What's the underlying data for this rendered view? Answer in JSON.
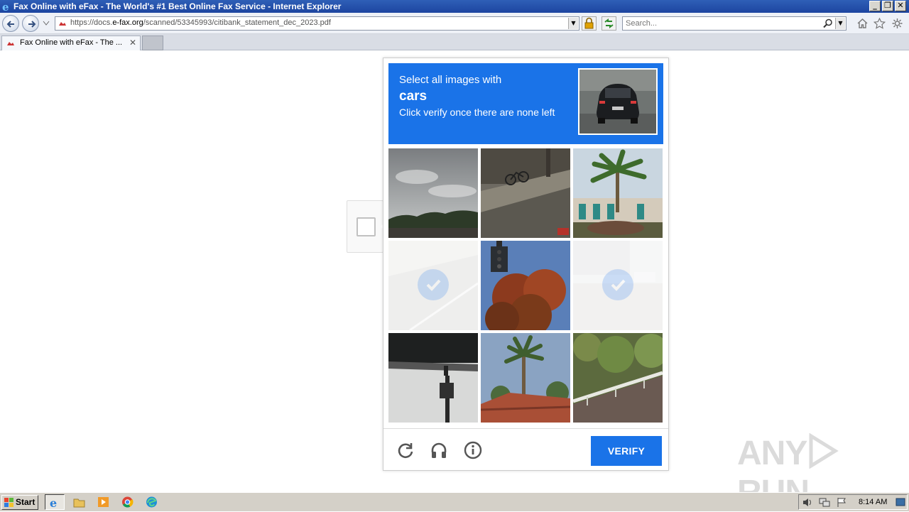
{
  "window": {
    "title": "Fax Online with eFax - The World's #1 Best Online Fax Service - Internet Explorer",
    "controls": [
      "_",
      "❐",
      "✕"
    ]
  },
  "address_bar": {
    "url_prefix": "https://docs.",
    "url_domain": "e-fax.org",
    "url_path": "/scanned/53345993/citibank_statement_dec_2023.pdf"
  },
  "search": {
    "placeholder": "Search..."
  },
  "tabs": [
    {
      "label": "Fax Online with eFax - The ...",
      "active": true
    }
  ],
  "captcha": {
    "instruction_line1": "Select all images with",
    "target_object": "cars",
    "instruction_line3": "Click verify once there are none left",
    "verify_label": "VERIFY",
    "tiles": [
      {
        "subject": "cloudy sky over hills",
        "selected": false
      },
      {
        "subject": "street with bicycle",
        "selected": false
      },
      {
        "subject": "palm tree by building",
        "selected": false
      },
      {
        "subject": "road",
        "selected": true
      },
      {
        "subject": "traffic light and tree",
        "selected": false
      },
      {
        "subject": "parking lot",
        "selected": true
      },
      {
        "subject": "overpass underside",
        "selected": false
      },
      {
        "subject": "palm tree and rooftop",
        "selected": false
      },
      {
        "subject": "hillside with guardrail",
        "selected": false
      }
    ],
    "footer_icons": [
      "reload-icon",
      "audio-headphones-icon",
      "info-icon"
    ]
  },
  "watermark": {
    "text_left": "ANY",
    "text_right": "RUN"
  },
  "taskbar": {
    "start_label": "Start",
    "pinned": [
      "internet-explorer-icon",
      "folder-icon",
      "media-player-icon",
      "chrome-icon",
      "edge-icon"
    ],
    "clock": "8:14 AM"
  }
}
